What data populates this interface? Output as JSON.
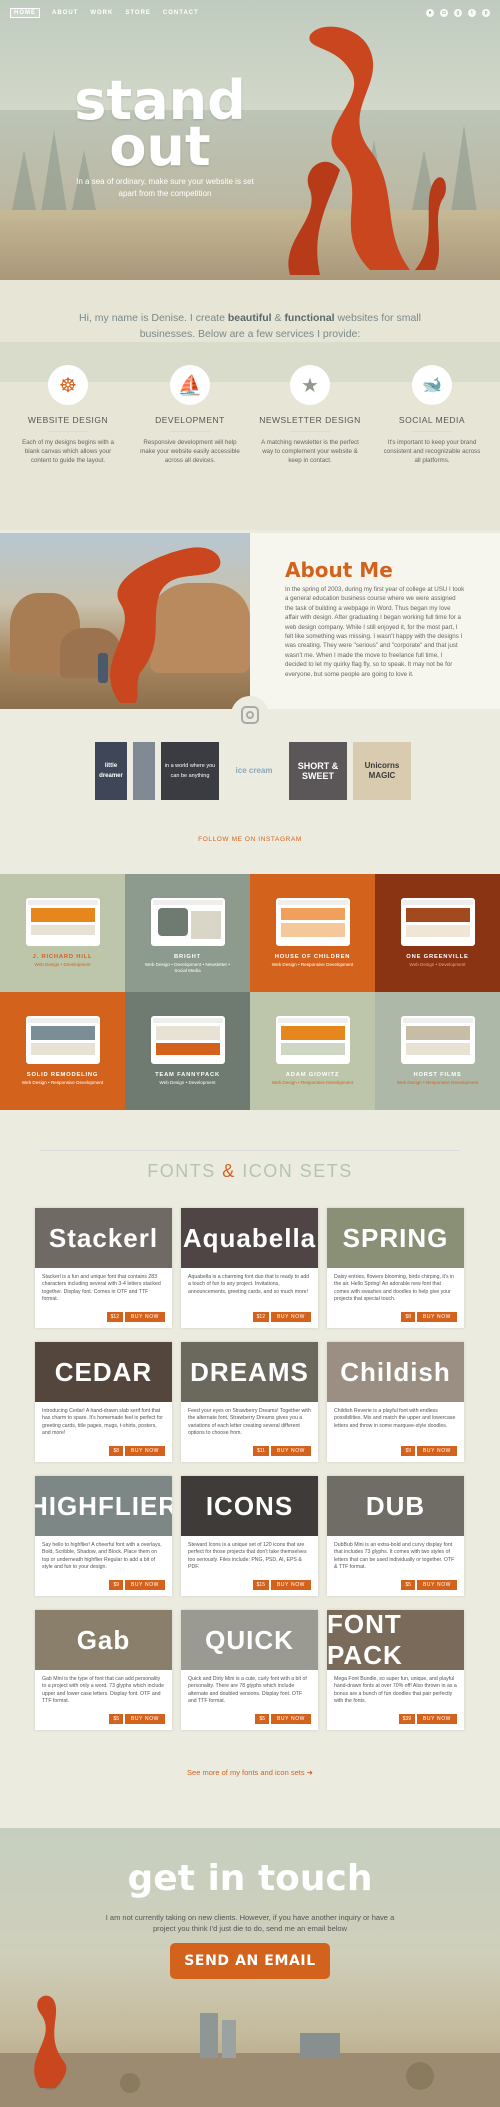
{
  "nav": {
    "items": [
      "HOME",
      "ABOUT",
      "WORK",
      "STORE",
      "CONTACT"
    ],
    "social": [
      "dribbble-icon",
      "instagram-icon",
      "google-plus-icon",
      "twitter-icon",
      "pinterest-icon"
    ]
  },
  "hero": {
    "title_line1": "stand",
    "title_line2": "out",
    "subtitle": "In a sea of ordinary, make sure your website is set apart from the competition"
  },
  "intro": {
    "text_start": "Hi, my name is Denise. I create ",
    "bold1": "beautiful",
    "mid": " & ",
    "bold2": "functional",
    "text_end": " websites for small businesses. Below are a few services I provide:"
  },
  "services": [
    {
      "icon": "ship-wheel-icon",
      "glyph": "☸",
      "title": "WEBSITE DESIGN",
      "desc": "Each of my designs begins with a blank canvas which allows your content to guide the layout."
    },
    {
      "icon": "pirate-ship-icon",
      "glyph": "⛵",
      "title": "DEVELOPMENT",
      "desc": "Responsive development will help make your website easily accessible across all devices."
    },
    {
      "icon": "starfish-icon",
      "glyph": "★",
      "title": "NEWSLETTER DESIGN",
      "desc": "A matching newsletter is the perfect way to complement your website & keep in contact."
    },
    {
      "icon": "whale-icon",
      "glyph": "🐋",
      "title": "SOCIAL MEDIA",
      "desc": "It's important to keep your brand consistent and recognizable across all platforms."
    }
  ],
  "about": {
    "title": "About Me",
    "text": "In the spring of 2003, during my first year of college at USU I took a general education business course where we were assigned the task of building a webpage in Word. Thus began my love affair with design. After graduating I began working full time for a web design company. While I still enjoyed it, for the most part, I felt like something was missing. I wasn't happy with the designs I was creating. They were \"serious\" and \"corporate\" and that just wasn't me. When I made the move to freelance full time, I decided to let my quirky flag fly, so to speak. It may not be for everyone, but some people are going to love it."
  },
  "instagram": {
    "tiles": [
      "little dreamer",
      "",
      "in a world where you can be anything",
      "ice cream",
      "SHORT & SWEET",
      "Unicorns MAGIC"
    ],
    "link": "FOLLOW ME ON INSTAGRAM"
  },
  "portfolio": [
    {
      "name": "J. RICHARD HILL",
      "tags": "Web Design • Development",
      "bg": "#bdc5ab",
      "name_color": "#d3631c",
      "tag_color": "#d3631c"
    },
    {
      "name": "BRIGHT",
      "tags": "Web Design • Development • Newsletter • Social Media",
      "bg": "#8d9a8e",
      "name_color": "#fff",
      "tag_color": "#fff"
    },
    {
      "name": "HOUSE OF CHILDREN",
      "tags": "Web Design • Responsive Development",
      "bg": "#d3631c",
      "name_color": "#fff",
      "tag_color": "#fff"
    },
    {
      "name": "ONE GREENVILLE",
      "tags": "Web Design • Development",
      "bg": "#8a3413",
      "name_color": "#fff",
      "tag_color": "#f1a57c"
    },
    {
      "name": "SOLID REMODELING",
      "tags": "Web Design • Responsive Development",
      "bg": "#d3631c",
      "name_color": "#fff",
      "tag_color": "#fff"
    },
    {
      "name": "TEAM FANNYPACK",
      "tags": "Web Design • Development",
      "bg": "#6f7a70",
      "name_color": "#fff",
      "tag_color": "#fff"
    },
    {
      "name": "ADAM GIOWITZ",
      "tags": "Web Design • Responsive Development",
      "bg": "#bdc5ab",
      "name_color": "#fff",
      "tag_color": "#d3631c"
    },
    {
      "name": "HORST FILMS",
      "tags": "Web Design • Responsive Development",
      "bg": "#aeb8a8",
      "name_color": "#fff",
      "tag_color": "#d3631c"
    }
  ],
  "fonts_section": {
    "title_a": "FONTS ",
    "amp": "&",
    "title_b": " ICON SETS"
  },
  "fonts": [
    {
      "name": "Stackerl",
      "desc": "Stackerl is a fun and unique font that contains 283 characters including several with 3-4 letters stacked together. Display font. Comes in OTF and TTF format.",
      "price": "$12",
      "buy": "BUY NOW",
      "bg": "#6f6a64"
    },
    {
      "name": "Aquabella",
      "desc": "Aquabella is a charming font duo that is ready to add a touch of fun to any project. Invitations, announcements, greeting cards, and so much more!",
      "price": "$12",
      "buy": "BUY NOW",
      "bg": "#4f4544"
    },
    {
      "name": "SPRING",
      "desc": "Daisy entries, flowers blooming, birds chirping, it's in the air. Hello Spring! An adorable new font that comes with swashes and doodles to help give your projects that special touch.",
      "price": "$8",
      "buy": "BUY NOW",
      "bg": "#8a9075"
    },
    {
      "name": "CEDAR",
      "desc": "Introducing Cedar! A hand-drawn slab serif font that has charm to spare. It's homemade feel is perfect for greeting cards, title pages, mugs, t-shirts, posters, and more!",
      "price": "$8",
      "buy": "BUY NOW",
      "bg": "#54463c"
    },
    {
      "name": "DREAMS",
      "desc": "Feed your eyes on Strawberry Dreams! Together with the alternate font, Strawberry Dreams gives you a variations of each letter creating several different options to choose from.",
      "price": "$11",
      "buy": "BUY NOW",
      "bg": "#6b685e"
    },
    {
      "name": "Childish",
      "desc": "Childish Reverie is a playful font with endless possibilities. Mix and match the upper and lowercase letters and throw in some marquee-style doodles.",
      "price": "$9",
      "buy": "BUY NOW",
      "bg": "#9a8f82"
    },
    {
      "name": "HIGHFLIER",
      "desc": "Say hello to highflier! A cheerful font with a overlays, Bold, Scribble, Shadow, and Block. Place them on top or underneath highflier Regular to add a bit of style and fun to your design.",
      "price": "$9",
      "buy": "BUY NOW",
      "bg": "#7c8786"
    },
    {
      "name": "ICONS",
      "desc": "Steward Icons is a unique set of 120 icons that are perfect for those projects that don't take themselves too seriously. Files include: PNG, PSD, AI, EPS & PDF.",
      "price": "$15",
      "buy": "BUY NOW",
      "bg": "#3e3b38"
    },
    {
      "name": "DUB",
      "desc": "DubBub Mini is an extra-bold and curvy display font that includes 73 glyphs. It comes with two styles of letters that can be used individually or together. OTF & TTF format.",
      "price": "$5",
      "buy": "BUY NOW",
      "bg": "#6f6d66"
    },
    {
      "name": "Gab",
      "desc": "Gab Mini is the type of font that can add personality to a project with only a word. 73 glyphs which include upper and lower case letters. Display font. OTF and TTF format.",
      "price": "$5",
      "buy": "BUY NOW",
      "bg": "#8a7f6a"
    },
    {
      "name": "QUICK",
      "desc": "Quick and Dirty Mini is a cute, curly font with a bit of personality. There are 78 glyphs which include alternate and doubled versions. Display font. OTF and TTF format.",
      "price": "$5",
      "buy": "BUY NOW",
      "bg": "#9a9a92"
    },
    {
      "name": "FONT PACK",
      "desc": "Mega Font Bundle, so super fun, unique, and playful hand-drawn fonts at over 70% off! Also thrown in as a bonus are a bunch of fun doodles that pair perfectly with the fonts.",
      "price": "$39",
      "buy": "BUY NOW",
      "bg": "#7a6a5a"
    }
  ],
  "more_link": "See more of my fonts and icon sets",
  "contact": {
    "title": "get in touch",
    "text": "I am not currently taking on new clients. However, if you have another inquiry or have a project you think I'd just die to do, send me an email below",
    "button": "SEND AN EMAIL"
  }
}
